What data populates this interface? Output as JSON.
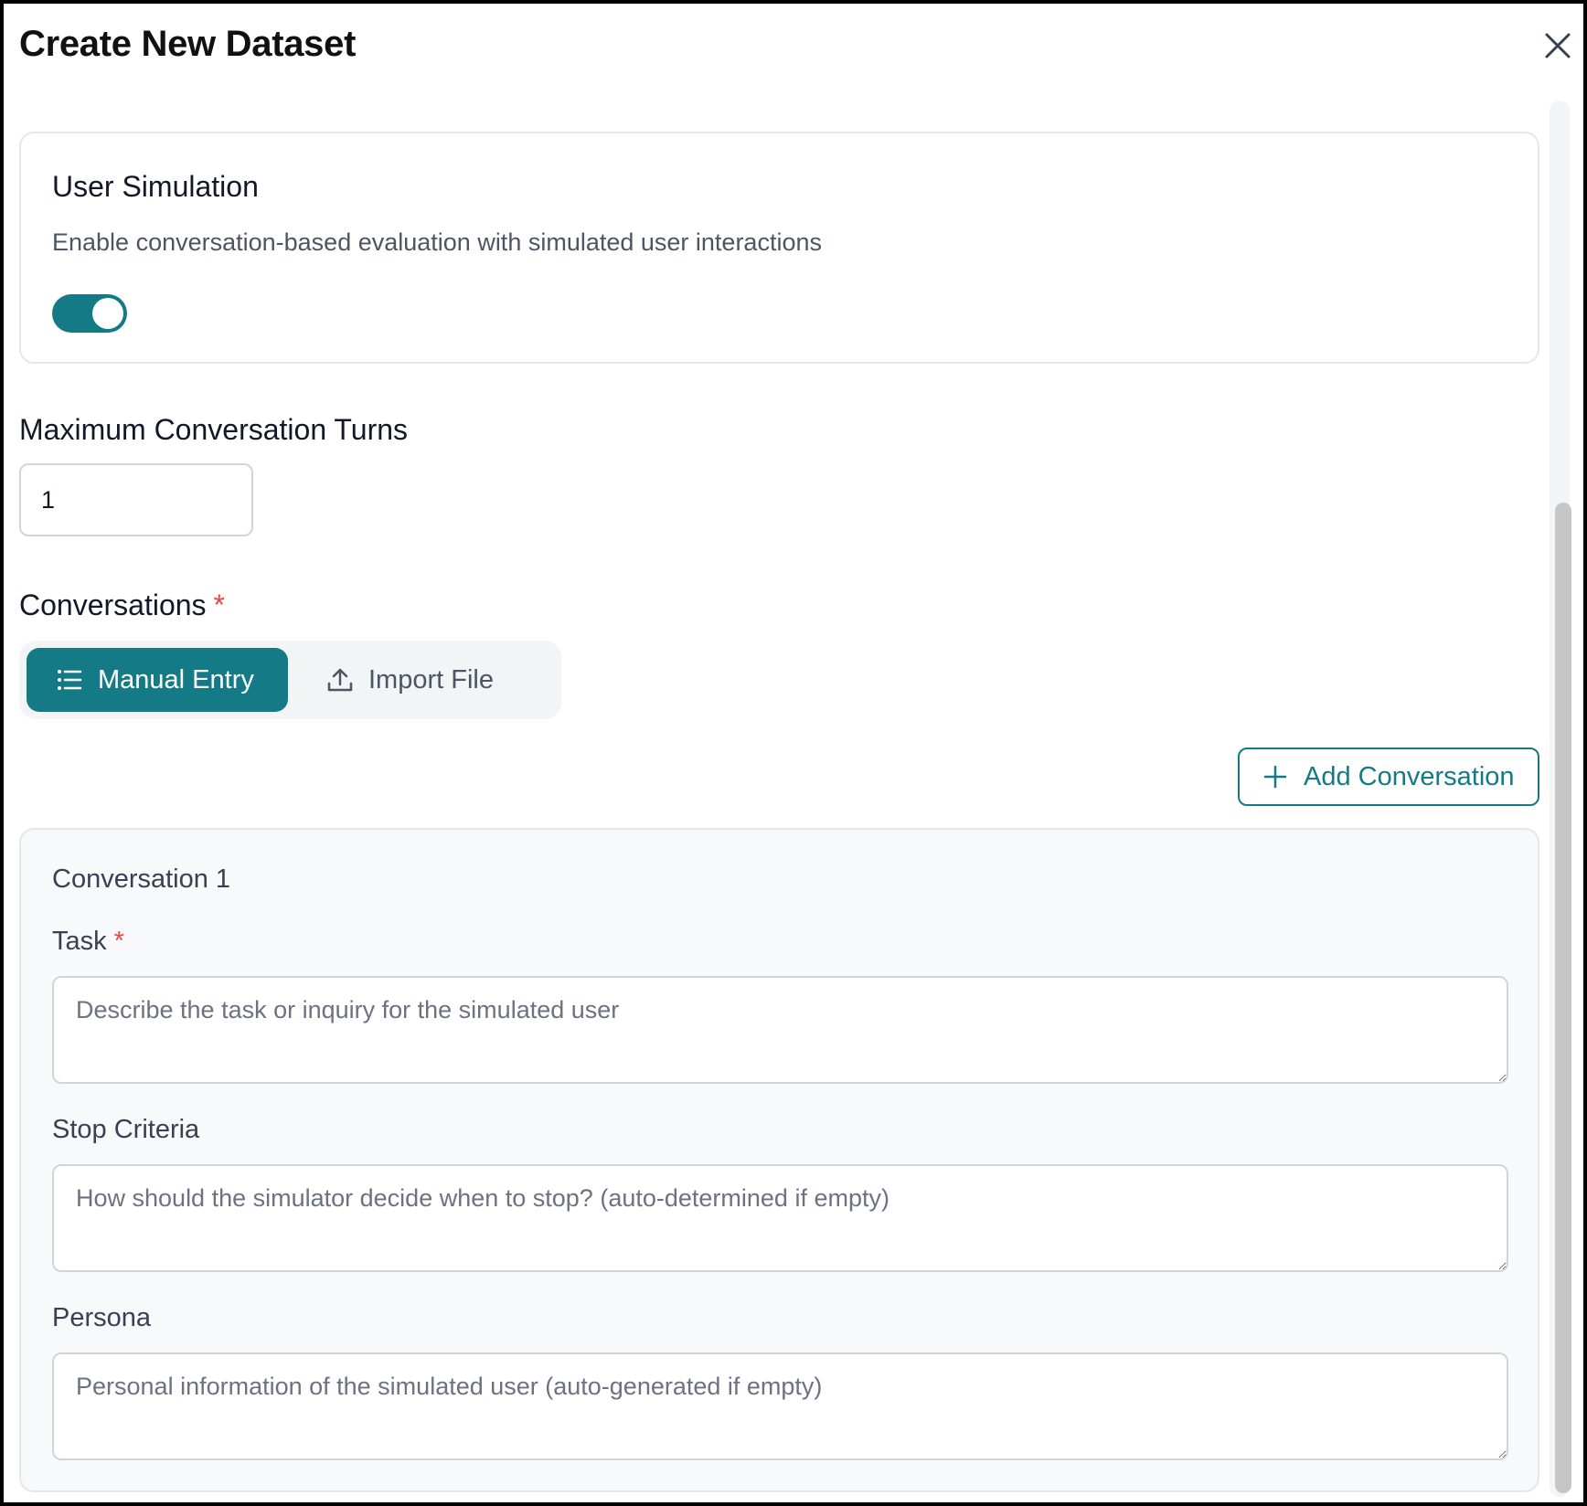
{
  "dialog": {
    "title": "Create New Dataset"
  },
  "user_simulation": {
    "title": "User Simulation",
    "description": "Enable conversation-based evaluation with simulated user interactions",
    "enabled": true,
    "accent_color": "#137a86"
  },
  "max_turns": {
    "label": "Maximum Conversation Turns",
    "value": "1"
  },
  "conversations": {
    "label": "Conversations",
    "required_mark": "*",
    "tabs": [
      {
        "label": "Manual Entry",
        "icon": "list-icon",
        "active": true
      },
      {
        "label": "Import File",
        "icon": "upload-icon",
        "active": false
      }
    ],
    "add_button_label": "Add Conversation",
    "items": [
      {
        "title": "Conversation 1",
        "task": {
          "label": "Task",
          "required_mark": "*",
          "value": "",
          "placeholder": "Describe the task or inquiry for the simulated user"
        },
        "stop_criteria": {
          "label": "Stop Criteria",
          "value": "",
          "placeholder": "How should the simulator decide when to stop? (auto-determined if empty)"
        },
        "persona": {
          "label": "Persona",
          "value": "",
          "placeholder": "Personal information of the simulated user (auto-generated if empty)"
        }
      }
    ]
  }
}
